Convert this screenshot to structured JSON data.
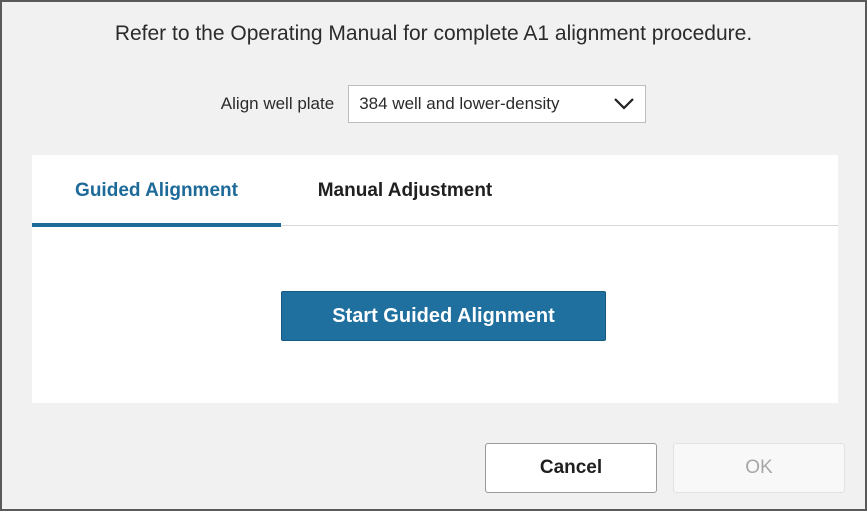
{
  "dialog": {
    "instruction": "Refer to the Operating Manual for complete A1 alignment procedure."
  },
  "plate": {
    "label": "Align well plate",
    "selected": "384 well and lower-density",
    "icon": "chevron-down-icon"
  },
  "tabs": [
    {
      "label": "Guided Alignment",
      "active": true
    },
    {
      "label": "Manual Adjustment",
      "active": false
    }
  ],
  "guided": {
    "start_label": "Start Guided Alignment"
  },
  "footer": {
    "cancel_label": "Cancel",
    "ok_label": "OK",
    "ok_enabled": false
  },
  "colors": {
    "accent": "#1e6a99",
    "primary_button": "#1f6f9f",
    "dialog_background": "#f1f1f1",
    "disabled_text": "#a7a7a7"
  }
}
